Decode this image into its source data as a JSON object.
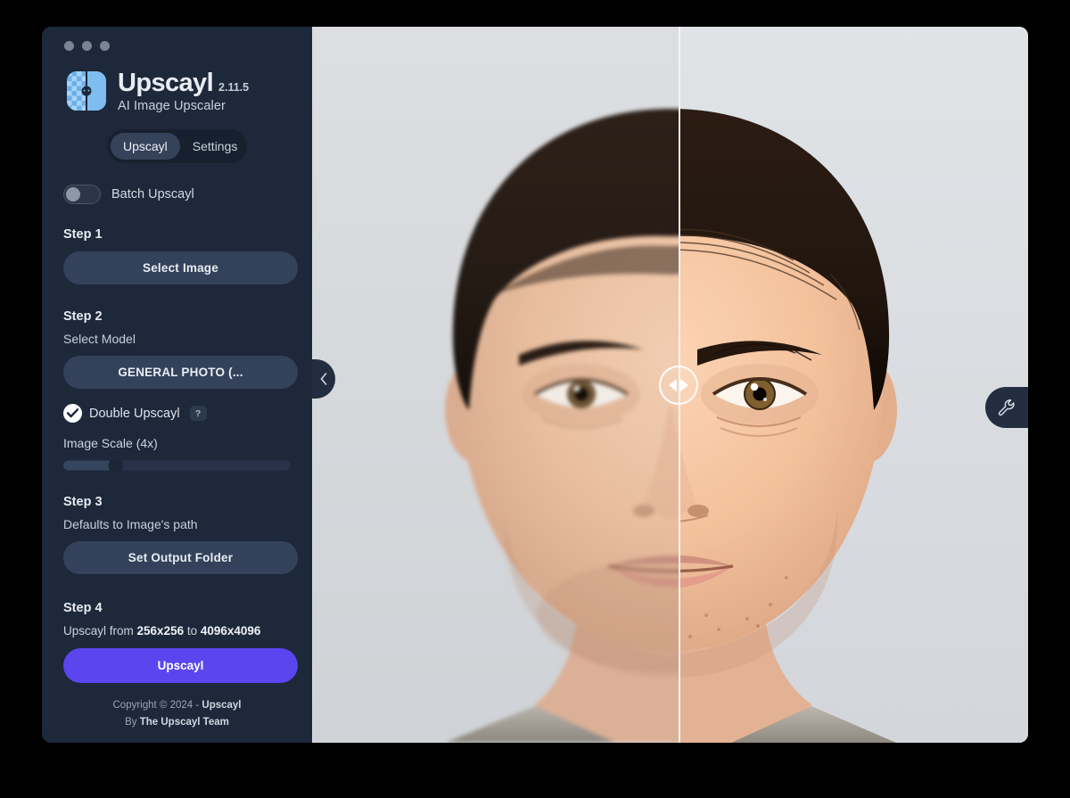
{
  "window": {
    "traffic_lights": [
      "close",
      "minimize",
      "maximize"
    ]
  },
  "brand": {
    "name": "Upscayl",
    "version": "2.11.5",
    "tagline": "AI Image Upscaler",
    "logo_icon": "upscayl-logo-icon"
  },
  "tabs": [
    {
      "label": "Upscayl",
      "active": true
    },
    {
      "label": "Settings",
      "active": false
    }
  ],
  "batch": {
    "label": "Batch Upscayl",
    "enabled": false
  },
  "step1": {
    "heading": "Step 1",
    "button": "Select Image"
  },
  "step2": {
    "heading": "Step 2",
    "sub": "Select Model",
    "model": "GENERAL PHOTO (...",
    "double_upscayl": {
      "label": "Double Upscayl",
      "checked": true,
      "help": "?"
    },
    "scale_label": "Image Scale (4x)",
    "scale_value": "4x",
    "scale_percent": 23
  },
  "step3": {
    "heading": "Step 3",
    "sub": "Defaults to Image's path",
    "button": "Set Output Folder"
  },
  "step4": {
    "heading": "Step 4",
    "info_prefix": "Upscayl from ",
    "info_from": "256x256",
    "info_mid": " to ",
    "info_to": "4096x4096",
    "button": "Upscayl"
  },
  "footer": {
    "line1_prefix": "Copyright © 2024 - ",
    "line1_bold": "Upscayl",
    "line2_prefix": "By ",
    "line2_bold": "The Upscayl Team"
  },
  "viewer": {
    "collapse_icon": "chevron-left-icon",
    "tools_icon": "wrench-icon",
    "handle_icon": "left-right-arrows-icon",
    "left_side": "original",
    "right_side": "upscaled",
    "divider_x_percent": 51
  },
  "colors": {
    "sidebar_bg": "#1d283a",
    "accent": "#5b45ef",
    "pill_bg": "#33425a",
    "viewer_bg": "#d6d8db"
  }
}
